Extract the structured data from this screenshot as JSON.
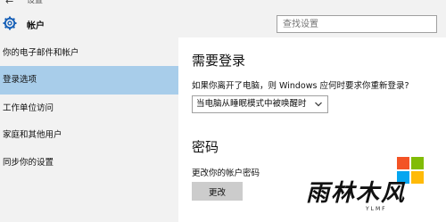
{
  "window": {
    "title": "设置"
  },
  "header": {
    "title": "帐户",
    "search_placeholder": "查找设置"
  },
  "sidebar": {
    "items": [
      {
        "label": "你的电子邮件和帐户",
        "active": false
      },
      {
        "label": "登录选项",
        "active": true
      },
      {
        "label": "工作单位访问",
        "active": false
      },
      {
        "label": "家庭和其他用户",
        "active": false
      },
      {
        "label": "同步你的设置",
        "active": false
      }
    ]
  },
  "main": {
    "signin_heading": "需要登录",
    "signin_question": "如果你离开了电脑，则 Windows 应何时要求你重新登录?",
    "signin_dropdown_value": "当电脑从睡眠模式中被唤醒时",
    "password_heading": "密码",
    "password_label": "更改你的帐户密码",
    "change_button": "更改"
  },
  "watermark": {
    "text": "雨林木风",
    "sub": "YLMF"
  },
  "colors": {
    "sidebar_bg": "#f2f2f2",
    "active_item": "#a8cdea",
    "button_bg": "#cccccc",
    "logo_red": "#f35325",
    "logo_green": "#81bc06",
    "logo_blue": "#05a6f0",
    "logo_yellow": "#ffba08"
  }
}
